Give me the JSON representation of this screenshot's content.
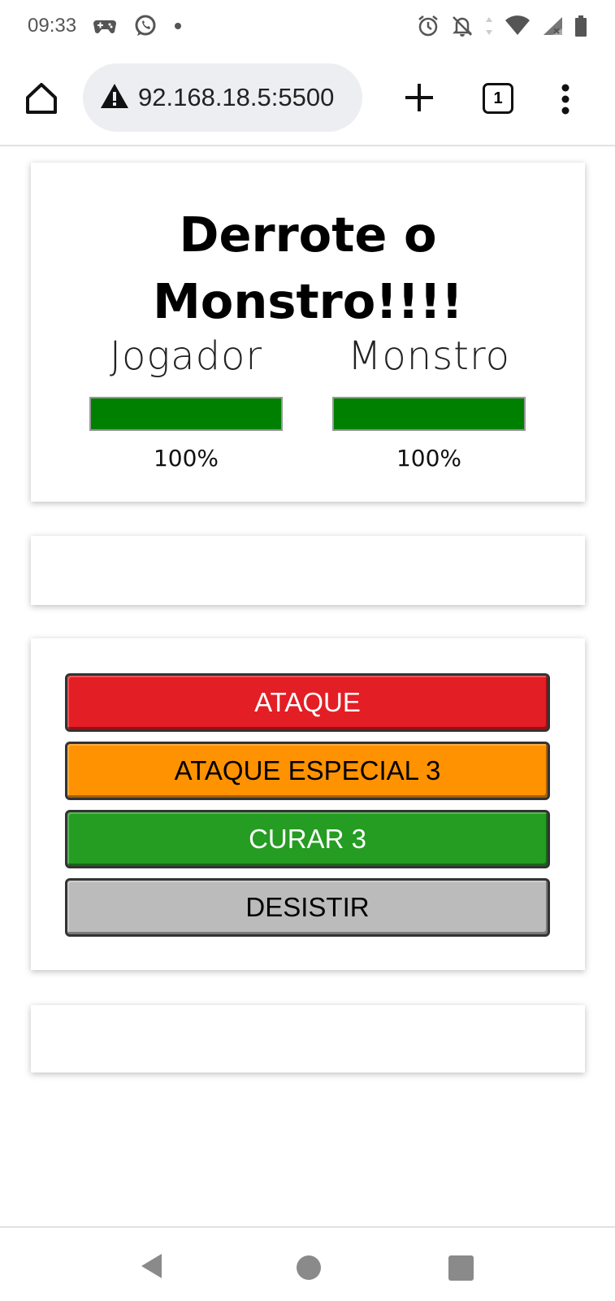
{
  "status_bar": {
    "time": "09:33",
    "left_icons": [
      "gamepad-icon",
      "whatsapp-icon",
      "dot-icon"
    ],
    "right_icons": [
      "alarm-icon",
      "notifications-off-icon",
      "data-arrows-icon",
      "wifi-icon",
      "signal-icon",
      "battery-icon"
    ]
  },
  "browser": {
    "url": "92.168.18.5:5500",
    "security_icon": "warning-icon",
    "tab_count": "1"
  },
  "game": {
    "title": "Derrote o Monstro!!!!",
    "player": {
      "label": "Jogador",
      "health_percent": 100,
      "health_text": "100%"
    },
    "monster": {
      "label": "Monstro",
      "health_percent": 100,
      "health_text": "100%"
    },
    "health_color": "#008000"
  },
  "actions": [
    {
      "label": "ATAQUE",
      "bg": "#e31e24",
      "fg": "#ffffff"
    },
    {
      "label": "ATAQUE ESPECIAL 3",
      "bg": "#ff9200",
      "fg": "#000000"
    },
    {
      "label": "CURAR 3",
      "bg": "#259c22",
      "fg": "#ffffff"
    },
    {
      "label": "DESISTIR",
      "bg": "#bbbbbb",
      "fg": "#000000"
    }
  ]
}
